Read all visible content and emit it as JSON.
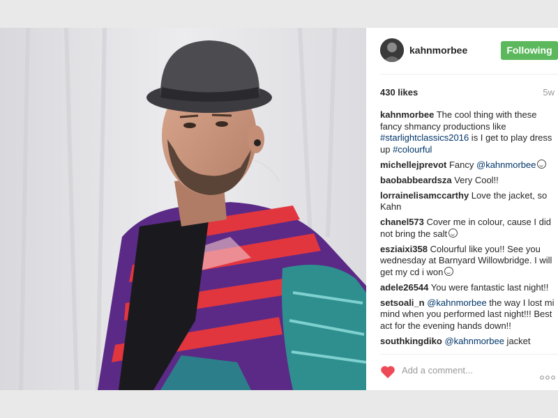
{
  "post": {
    "author": "kahnmorbee",
    "follow_label": "Following",
    "likes": "430 likes",
    "age": "5w",
    "caption": {
      "user": "kahnmorbee",
      "text_1": " The cool thing with these fancy shmancy productions like ",
      "tag_1": "#starlightclassics2016",
      "text_2": " is I get to play dress up ",
      "tag_2": "#colourful"
    },
    "comments": [
      {
        "user": "michellejprevot",
        "text_1": " Fancy ",
        "mention": "@kahnmorbee",
        "emoji": "smile"
      },
      {
        "user": "baobabbeardsza",
        "text_1": " Very Cool!!"
      },
      {
        "user": "lorrainelisamccarthy",
        "text_1": " Love the jacket, so Kahn"
      },
      {
        "user": "chanel573",
        "text_1": " Cover me in colour, cause I did not bring the salt",
        "emoji": "laugh"
      },
      {
        "user": "esziaixi358",
        "text_1": " Colourful like you!! See you wednesday at Barnyard Willowbridge. I will get my cd i won",
        "emoji": "smile"
      },
      {
        "user": "adele26544",
        "text_1": " You were fantastic last night!!"
      },
      {
        "user": "setsoali_n",
        "text_1": " ",
        "mention": "@kahnmorbee",
        "text_2": " the way I lost mi mind when you performed last night!!! Best act for the evening hands down!!"
      },
      {
        "user": "southkingdiko",
        "text_1": " ",
        "mention": "@kahnmorbee",
        "text_2": " jacket"
      }
    ],
    "add_comment_placeholder": "Add a comment...",
    "icons": {
      "like": "heart-icon",
      "options": "more-options-icon"
    },
    "colors": {
      "follow_button": "#5cb85c",
      "heart": "#ed4956",
      "hashtag": "#003569"
    }
  }
}
